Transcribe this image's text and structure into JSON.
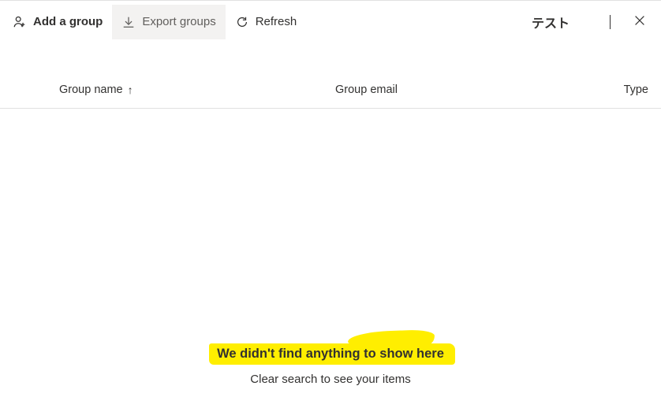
{
  "toolbar": {
    "add_label": "Add a group",
    "export_label": "Export groups",
    "refresh_label": "Refresh"
  },
  "search": {
    "value": "テスト"
  },
  "columns": {
    "name": "Group name",
    "email": "Group email",
    "type": "Type"
  },
  "empty_state": {
    "headline": "We didn't find anything to show here",
    "subtext": "Clear search to see your items"
  }
}
